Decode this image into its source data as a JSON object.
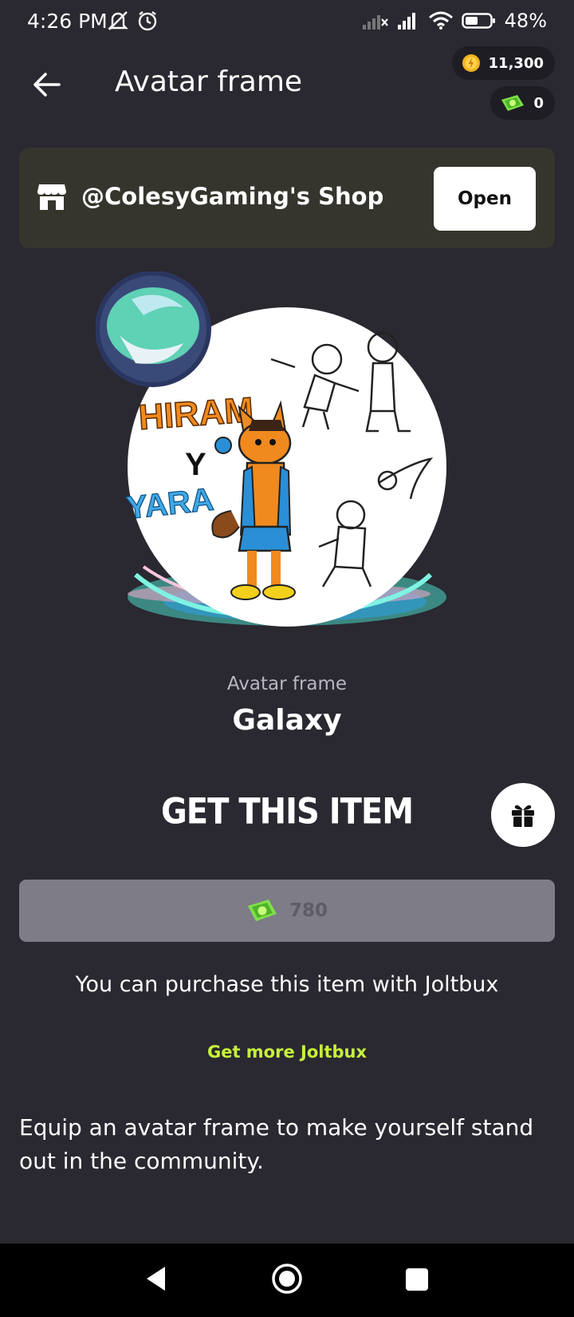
{
  "status_bar": {
    "time": "4:26 PM",
    "battery": "48%"
  },
  "header": {
    "title": "Avatar frame",
    "coins": "11,300",
    "joltbux": "0"
  },
  "shop": {
    "name": "@ColesyGaming's Shop",
    "open_label": "Open"
  },
  "avatar_art": {
    "title_top": "HIRAM",
    "title_mid": "Y",
    "title_bottom": "YARA"
  },
  "item": {
    "type": "Avatar frame",
    "name": "Galaxy"
  },
  "purchase": {
    "heading": "GET THIS ITEM",
    "price": "780",
    "note": "You can purchase this item with Joltbux",
    "get_more": "Get more Joltbux"
  },
  "description": "Equip an avatar frame to make yourself stand out in the community.",
  "colors": {
    "background": "#2a2830",
    "accent": "#c6f23b",
    "shop_card": "#35352d",
    "price_button": "#7e7c86"
  }
}
